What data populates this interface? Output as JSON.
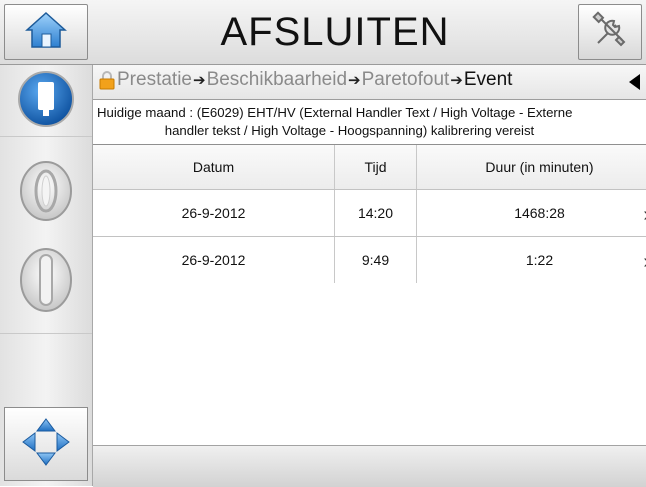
{
  "header": {
    "title": "AFSLUITEN",
    "home_icon": "home-icon",
    "tools_icon": "tools-icon"
  },
  "breadcrumb": {
    "lock_icon": "lock-icon",
    "items": [
      "Prestatie",
      "Beschikbaarheid",
      "Paretofout",
      "Event"
    ],
    "back_icon": "back-triangle-icon"
  },
  "info": {
    "line1": "Huidige maand : (E6029) EHT/HV (External Handler Text / High Voltage - Externe",
    "line2": "handler tekst / High Voltage - Hoogspanning) kalibrering vereist"
  },
  "table": {
    "headers": [
      "Datum",
      "Tijd",
      "Duur (in minuten)"
    ],
    "rows": [
      [
        "26-9-2012",
        "14:20",
        "1468:28"
      ],
      [
        "26-9-2012",
        "9:49",
        "1:22"
      ]
    ]
  },
  "sidebar": {
    "items": [
      "printer-status-icon",
      "start-jet-icon",
      "stop-jet-icon",
      "navigation-arrows-icon"
    ]
  },
  "colors": {
    "status_blue": "#1565c0",
    "home_blue": "#5aa6e8",
    "nav_blue": "#3b8fe0"
  }
}
